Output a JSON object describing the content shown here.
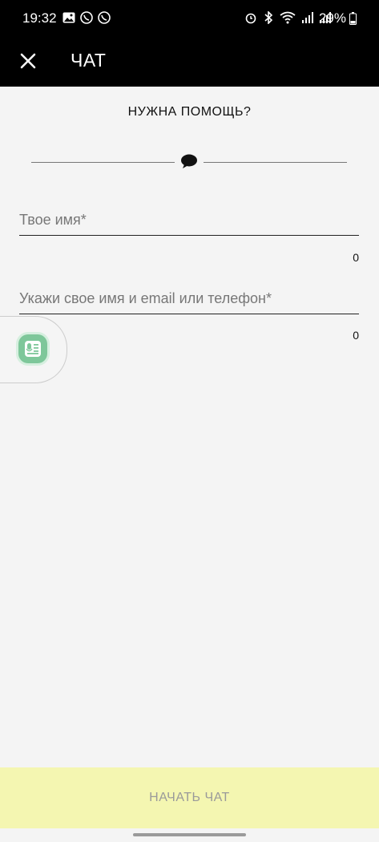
{
  "status_bar": {
    "time": "19:32",
    "battery": "29%",
    "left_icons": [
      "gallery-icon",
      "viber-icon",
      "viber-icon"
    ],
    "right_icons": [
      "alarm-icon",
      "bluetooth-icon",
      "wifi-icon",
      "signal-icon",
      "signal-icon"
    ]
  },
  "header": {
    "title": "ЧАТ"
  },
  "help": {
    "title": "НУЖНА ПОМОЩЬ?"
  },
  "form": {
    "name_placeholder": "Твое имя*",
    "name_counter": "0",
    "contact_placeholder": "Укажи свое имя и email или телефон*",
    "contact_counter": "0"
  },
  "footer": {
    "start_button": "НАЧАТЬ ЧАТ"
  },
  "colors": {
    "header_bg": "#000000",
    "page_bg": "#f4f4f4",
    "button_bg": "#f4f6b1",
    "floating_accent": "#7ec79a"
  }
}
